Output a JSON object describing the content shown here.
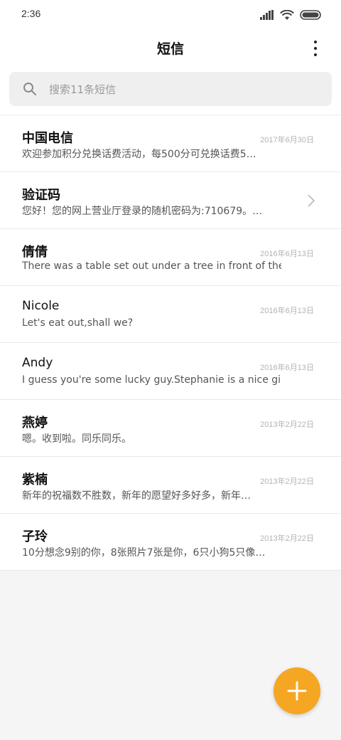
{
  "status_bar": {
    "time": "2:36",
    "icons": [
      "cellular-signal-icon",
      "wifi-icon",
      "battery-icon"
    ]
  },
  "header": {
    "title": "短信",
    "more_icon": "more-vertical-icon"
  },
  "search": {
    "placeholder": "搜索11条短信",
    "icon": "search-icon"
  },
  "messages": [
    {
      "name": "中国电信",
      "date": "2017年6月30日",
      "preview": "欢迎参加积分兑换话费活动，每500分可兑换话费5…",
      "has_chevron": false
    },
    {
      "name": "验证码",
      "date": "",
      "preview": "您好！您的网上营业厅登录的随机密码为:710679。…",
      "has_chevron": true
    },
    {
      "name": "倩倩",
      "date": "2016年6月13日",
      "preview": "There was a table set out under a tree in front of the h…",
      "has_chevron": false
    },
    {
      "name": "Nicole",
      "date": "2016年6月13日",
      "preview": "Let's eat out,shall we?",
      "has_chevron": false
    },
    {
      "name": "Andy",
      "date": "2016年6月13日",
      "preview": "I guess you're some lucky guy.Stephanie is a nice girl.",
      "has_chevron": false
    },
    {
      "name": "燕婷",
      "date": "2013年2月22日",
      "preview": "嗯。收到啦。同乐同乐。",
      "has_chevron": false
    },
    {
      "name": "紫楠",
      "date": "2013年2月22日",
      "preview": "新年的祝福数不胜数，新年的愿望好多好多，新年…",
      "has_chevron": false
    },
    {
      "name": "子玲",
      "date": "2013年2月22日",
      "preview": "10分想念9别的你，8张照片7张是你，6只小狗5只像…",
      "has_chevron": false
    }
  ],
  "fab": {
    "icon": "plus-icon"
  },
  "colors": {
    "accent": "#f5a623",
    "background": "#f5f5f5",
    "date_text": "#b3b3b3"
  }
}
